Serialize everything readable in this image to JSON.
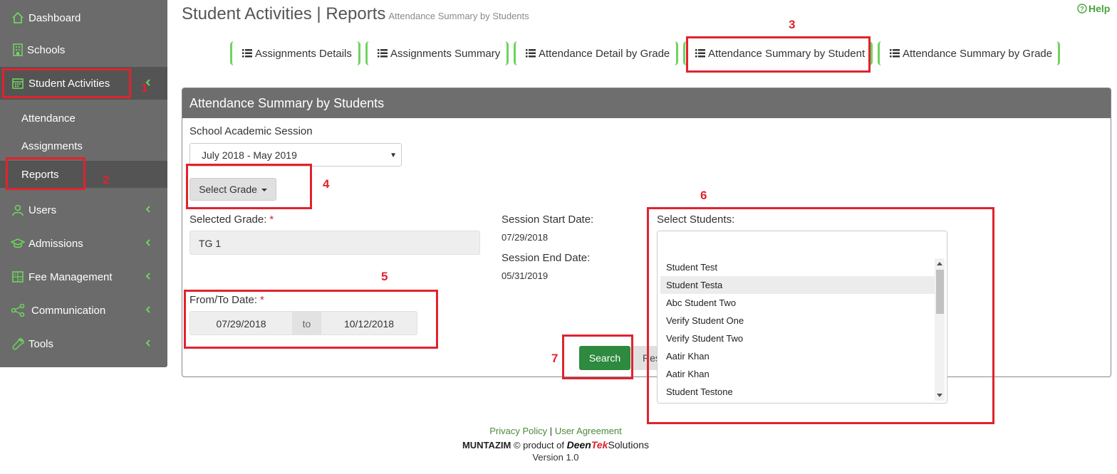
{
  "sidebar": {
    "items": [
      {
        "label": "Dashboard",
        "icon": "home-icon"
      },
      {
        "label": "Schools",
        "icon": "building-icon"
      },
      {
        "label": "Student Activities",
        "icon": "calendar-icon"
      },
      {
        "label": "Users",
        "icon": "user-icon"
      },
      {
        "label": "Admissions",
        "icon": "graduation-cap-icon"
      },
      {
        "label": "Fee Management",
        "icon": "calculator-icon"
      },
      {
        "label": "Communication",
        "icon": "share-icon"
      },
      {
        "label": "Tools",
        "icon": "wrench-icon"
      }
    ],
    "sub_items": [
      {
        "label": "Attendance"
      },
      {
        "label": "Assignments"
      },
      {
        "label": "Reports"
      }
    ]
  },
  "header": {
    "title": "Student Activities | Reports",
    "subtitle": "Attendance Summary by Students",
    "help_label": "Help"
  },
  "tabs": [
    {
      "label": "Assignments Details"
    },
    {
      "label": "Assignments Summary"
    },
    {
      "label": "Attendance Detail by Grade"
    },
    {
      "label": "Attendance Summary by Student"
    },
    {
      "label": "Attendance Summary by Grade"
    }
  ],
  "panel": {
    "title": "Attendance Summary by Students",
    "session_label": "School Academic Session",
    "session_value": "July 2018 - May 2019",
    "select_grade_label": "Select Grade",
    "selected_grade_label": "Selected Grade:",
    "required_mark": "*",
    "selected_grade_value": "TG 1",
    "session_start_label": "Session Start Date:",
    "session_start_value": "07/29/2018",
    "session_end_label": "Session End Date:",
    "session_end_value": "05/31/2019",
    "from_to_label": "From/To Date:",
    "from_date": "07/29/2018",
    "to_label": "to",
    "to_date": "10/12/2018",
    "select_students_label": "Select Students:",
    "students": [
      "Student Test",
      "Student Testa",
      "Abc Student Two",
      "Verify Student One",
      "Verify Student Two",
      "Aatir Khan",
      "Aatir Khan",
      "Student Testone"
    ],
    "search_label": "Search",
    "reset_label": "Reset"
  },
  "annotations": [
    "1",
    "2",
    "3",
    "4",
    "5",
    "6",
    "7"
  ],
  "footer": {
    "privacy": "Privacy Policy",
    "separator": "|",
    "agreement": "User Agreement",
    "brand": "MUNTAZIM",
    "product_of": "© product of",
    "logo_deen": "Deen",
    "logo_tek": "Tek",
    "logo_solutions": "Solutions",
    "version": "Version 1.0"
  },
  "colors": {
    "sidebar_bg": "#6b6b6b",
    "accent_green": "#6fd35f",
    "search_button": "#2d8a3e",
    "annotation_red": "#e0232e"
  }
}
